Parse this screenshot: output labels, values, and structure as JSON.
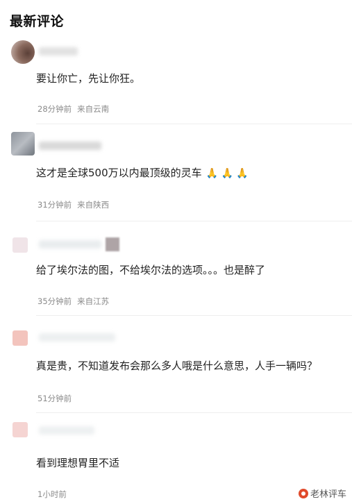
{
  "section_title": "最新评论",
  "comments": [
    {
      "text": "要让你亡，先让你狂。",
      "time": "28分钟前",
      "location": "来自云南",
      "avatar_color": "#8a6a5e"
    },
    {
      "text": "这才是全球500万以内最顶级的灵车",
      "emoji": "🙏 🙏 🙏",
      "time": "31分钟前",
      "location": "来自陕西",
      "avatar_color": "#9aa0a8"
    },
    {
      "text": "给了埃尔法的图，不给埃尔法的选项。。。也是醉了",
      "time": "35分钟前",
      "location": "来自江苏",
      "avatar_color": "#ead7dc"
    },
    {
      "text": "真是贵，不知道发布会那么多人哦是什么意思，人手一辆吗？",
      "time": "51分钟前",
      "location": "",
      "avatar_color": "#f3c4bd"
    },
    {
      "text": "看到理想胃里不适",
      "time": "1小时前",
      "location": "",
      "avatar_color": "#f5d4d2"
    }
  ],
  "watermark": "老林评车"
}
